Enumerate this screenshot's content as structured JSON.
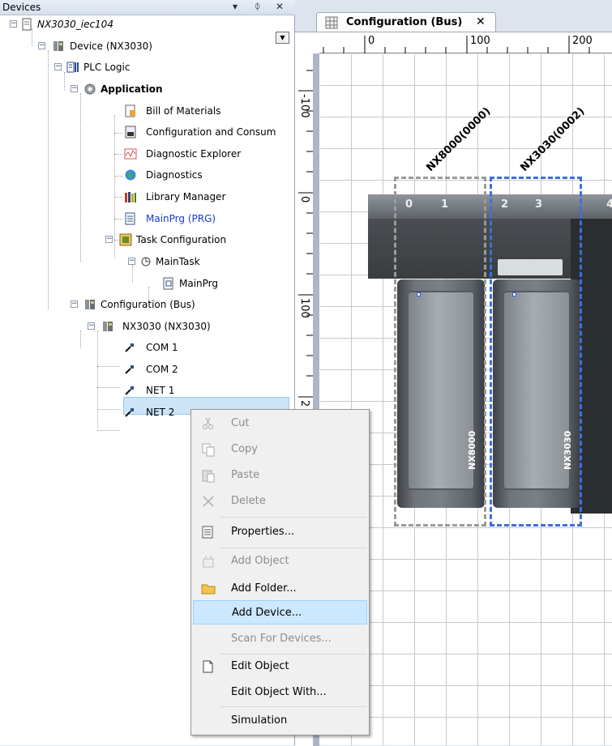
{
  "devices_panel": {
    "title": "Devices",
    "buttons": {
      "dropdown": "▾",
      "pin": "ᛰ",
      "close": "✕"
    }
  },
  "tree": {
    "project": "NX3030_iec104",
    "device": "Device (NX3030)",
    "plc_logic": "PLC Logic",
    "application": "Application",
    "bill_of_materials": "Bill of Materials",
    "configuration_consumption": "Configuration and Consum",
    "diagnostic_explorer": "Diagnostic Explorer",
    "diagnostics": "Diagnostics",
    "library_manager": "Library Manager",
    "mainprg": "MainPrg (PRG)",
    "task_configuration": "Task Configuration",
    "maintask": "MainTask",
    "maintask_mainprg": "MainPrg",
    "configuration_bus": "Configuration (Bus)",
    "nx3030": "NX3030 (NX3030)",
    "com1": "COM 1",
    "com2": "COM 2",
    "net1": "NET 1",
    "net2": "NET 2"
  },
  "editor": {
    "tab_label": "Configuration (Bus)",
    "tab_close": "✕",
    "ruler_top": [
      "0",
      "100",
      "200"
    ],
    "ruler_left": [
      "-100",
      "0",
      "100",
      "2"
    ],
    "slot_numbers": [
      "0",
      "1",
      "2",
      "3",
      "4"
    ],
    "modules": [
      {
        "title": "NX8000(0000)",
        "name": "NX8000"
      },
      {
        "title": "NX3030(0002)",
        "name": "NX3030"
      }
    ],
    "colors": {
      "selection_gray": "#9a9a9a",
      "selection_blue": "#3c6fe0"
    }
  },
  "context_menu": {
    "items": [
      {
        "label": "Cut",
        "icon": "scissors-icon",
        "disabled": true
      },
      {
        "label": "Copy",
        "icon": "copy-icon",
        "disabled": true
      },
      {
        "label": "Paste",
        "icon": "paste-icon",
        "disabled": true
      },
      {
        "label": "Delete",
        "icon": "delete-icon",
        "disabled": true
      },
      {
        "label": "Properties...",
        "icon": "properties-icon",
        "disabled": false
      },
      {
        "label": "Add Object",
        "icon": "add-object-icon",
        "disabled": true
      },
      {
        "label": "Add Folder...",
        "icon": "folder-icon",
        "disabled": false
      },
      {
        "label": "Add Device...",
        "icon": "",
        "disabled": false,
        "highlighted": true
      },
      {
        "label": "Scan For Devices...",
        "icon": "",
        "disabled": true
      },
      {
        "label": "Edit Object",
        "icon": "edit-object-icon",
        "disabled": false
      },
      {
        "label": "Edit Object With...",
        "icon": "",
        "disabled": false
      },
      {
        "label": "Simulation",
        "icon": "",
        "disabled": false
      }
    ]
  }
}
